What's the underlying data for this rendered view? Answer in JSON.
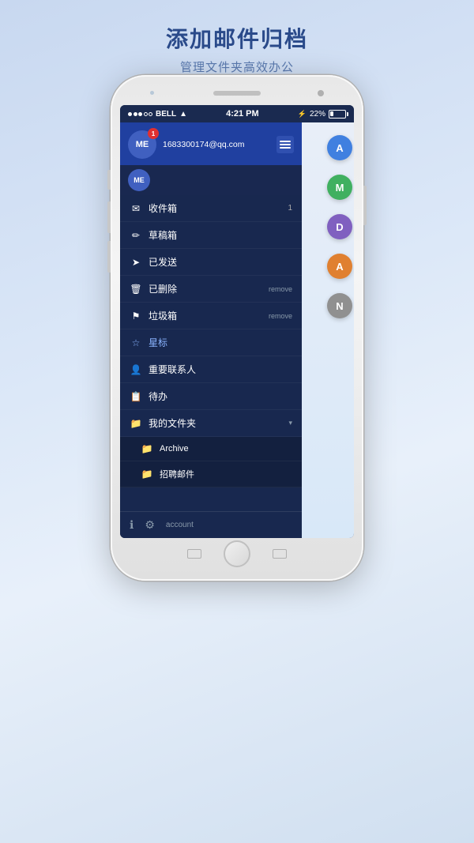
{
  "title": {
    "main": "添加邮件归档",
    "sub": "管理文件夹高效办公"
  },
  "status_bar": {
    "dots": [
      "filled",
      "filled",
      "filled",
      "empty",
      "empty"
    ],
    "carrier": "BELL",
    "wifi": "wifi",
    "time": "4:21 PM",
    "bluetooth": "bluetooth",
    "battery_percent": "22%"
  },
  "sidebar": {
    "email": "1683300174@qq.com",
    "avatar_label": "ME",
    "avatar_badge": "1",
    "menu_items": [
      {
        "icon": "✉",
        "label": "收件箱",
        "badge": "1",
        "remove": ""
      },
      {
        "icon": "✏",
        "label": "草稿箱",
        "badge": "",
        "remove": ""
      },
      {
        "icon": "➤",
        "label": "已发送",
        "badge": "",
        "remove": ""
      },
      {
        "icon": "🗑",
        "label": "已删除",
        "badge": "",
        "remove": "remove"
      },
      {
        "icon": "⚑",
        "label": "垃圾箱",
        "badge": "",
        "remove": "remove"
      },
      {
        "icon": "☆",
        "label": "星标",
        "badge": "",
        "remove": "",
        "highlighted": true
      },
      {
        "icon": "👤",
        "label": "重要联系人",
        "badge": "",
        "remove": ""
      },
      {
        "icon": "📋",
        "label": "待办",
        "badge": "",
        "remove": ""
      },
      {
        "icon": "📁",
        "label": "我的文件夹",
        "badge": "",
        "remove": "",
        "arrow": "▾"
      },
      {
        "icon": "📁",
        "label": "Archive",
        "badge": "",
        "remove": "",
        "subfolder": true
      },
      {
        "icon": "📁",
        "label": "招聘邮件",
        "badge": "",
        "remove": "",
        "subfolder": true
      }
    ],
    "footer": {
      "account_label": "account"
    }
  },
  "fabs": [
    {
      "label": "A",
      "color": "blue"
    },
    {
      "label": "M",
      "color": "green"
    },
    {
      "label": "D",
      "color": "purple"
    },
    {
      "label": "A",
      "color": "orange"
    },
    {
      "label": "N",
      "color": "gray"
    }
  ]
}
